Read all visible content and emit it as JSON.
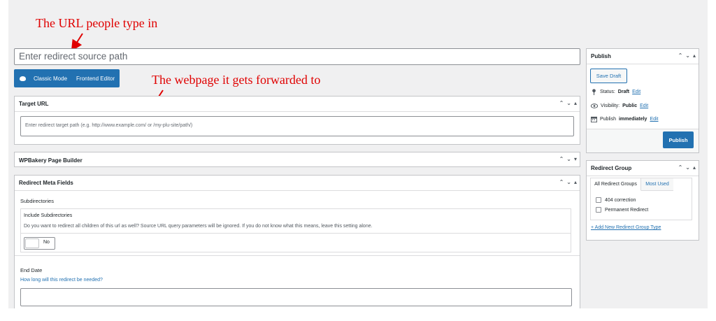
{
  "annotations": {
    "source_note": "The URL people type in",
    "target_note": "The webpage it gets forwarded to"
  },
  "title_placeholder": "Enter redirect source path",
  "editor_modes": {
    "classic": "Classic Mode",
    "frontend": "Frontend Editor"
  },
  "target_url_box": {
    "title": "Target URL",
    "placeholder": "Enter redirect target path (e.g. http://www.example.com/ or /my-plu-site/path/)"
  },
  "wpbakery_box": {
    "title": "WPBakery Page Builder"
  },
  "meta_box": {
    "title": "Redirect Meta Fields",
    "subdirectories": {
      "heading": "Subdirectories",
      "label": "Include Subdirectories",
      "description": "Do you want to redirect all children of this url as well? Source URL query parameters will be ignored. If you do not know what this means, leave this setting alone.",
      "toggle_value": "No"
    },
    "end_date": {
      "heading": "End Date",
      "description": "How long will this redirect be needed?",
      "value": ""
    }
  },
  "publish_box": {
    "title": "Publish",
    "save_draft": "Save Draft",
    "status_label": "Status:",
    "status_value": "Draft",
    "visibility_label": "Visibility:",
    "visibility_value": "Public",
    "publish_label": "Publish",
    "publish_value": "immediately",
    "edit_link": "Edit",
    "publish_button": "Publish"
  },
  "redirect_group_box": {
    "title": "Redirect Group",
    "tabs": [
      "All Redirect Groups",
      "Most Used"
    ],
    "active_tab": "All Redirect Groups",
    "options": [
      {
        "label": "404 correction",
        "checked": false
      },
      {
        "label": "Permanent Redirect",
        "checked": false
      }
    ],
    "add_new_link": "+ Add New Redirect Group Type"
  },
  "colors": {
    "accent": "#2271b1",
    "annotation": "#e00000",
    "background": "#f0f0f1"
  },
  "icons": {
    "mode_toggle": "wpbakery-icon",
    "status": "pin-icon",
    "visibility": "eye-icon",
    "schedule": "calendar-icon"
  }
}
